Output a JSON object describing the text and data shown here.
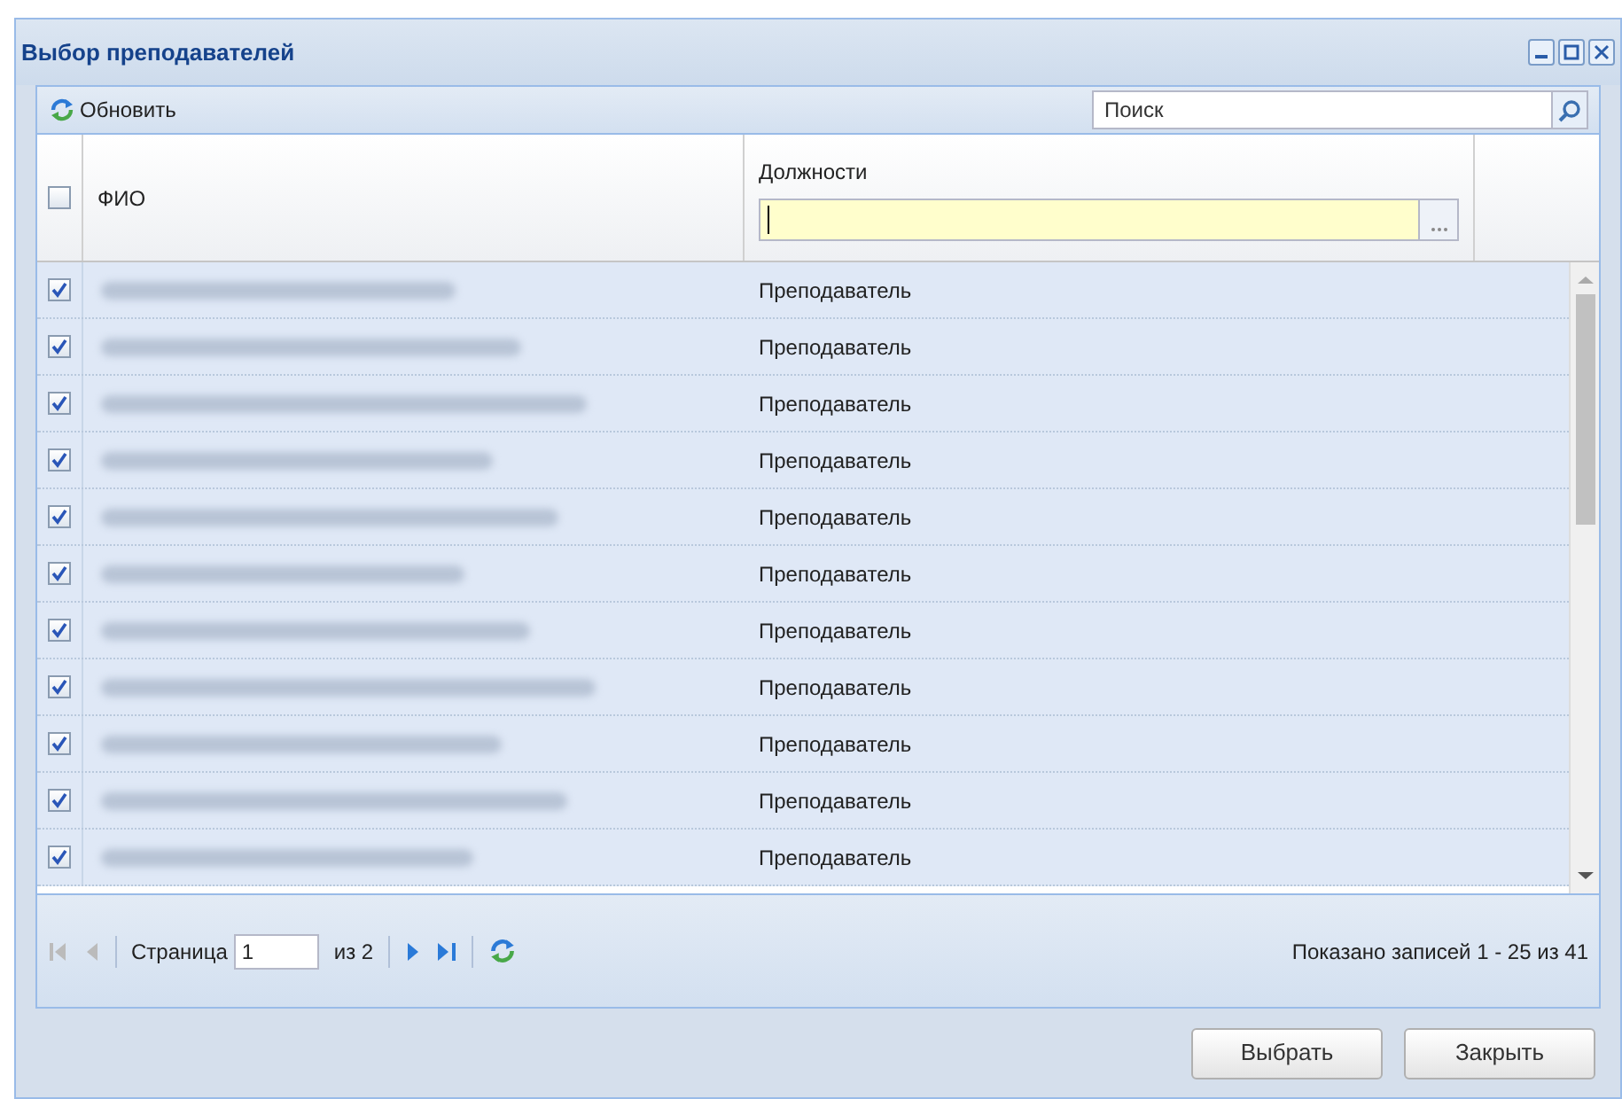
{
  "window": {
    "title": "Выбор преподавателей"
  },
  "toolbar": {
    "refresh_label": "Обновить",
    "search": {
      "placeholder": "Поиск"
    }
  },
  "table": {
    "select_all": {
      "checked": false
    },
    "columns": [
      {
        "title": "ФИО"
      },
      {
        "title": "Должности"
      }
    ],
    "filter": {
      "focused": true
    },
    "rows": [
      {
        "checked": true,
        "position": "Преподаватель"
      },
      {
        "checked": true,
        "position": "Преподаватель"
      },
      {
        "checked": true,
        "position": "Преподаватель"
      },
      {
        "checked": true,
        "position": "Преподаватель"
      },
      {
        "checked": true,
        "position": "Преподаватель"
      },
      {
        "checked": true,
        "position": "Преподаватель"
      },
      {
        "checked": true,
        "position": "Преподаватель"
      },
      {
        "checked": true,
        "position": "Преподаватель"
      },
      {
        "checked": true,
        "position": "Преподаватель"
      },
      {
        "checked": true,
        "position": "Преподаватель"
      },
      {
        "checked": true,
        "position": "Преподаватель"
      }
    ]
  },
  "pager": {
    "page_label": "Страница",
    "page": "1",
    "of": "из 2",
    "summary": "Показано записей 1 - 25 из 41"
  },
  "buttons": [
    {
      "label": "Выбрать"
    },
    {
      "label": "Закрыть"
    }
  ]
}
